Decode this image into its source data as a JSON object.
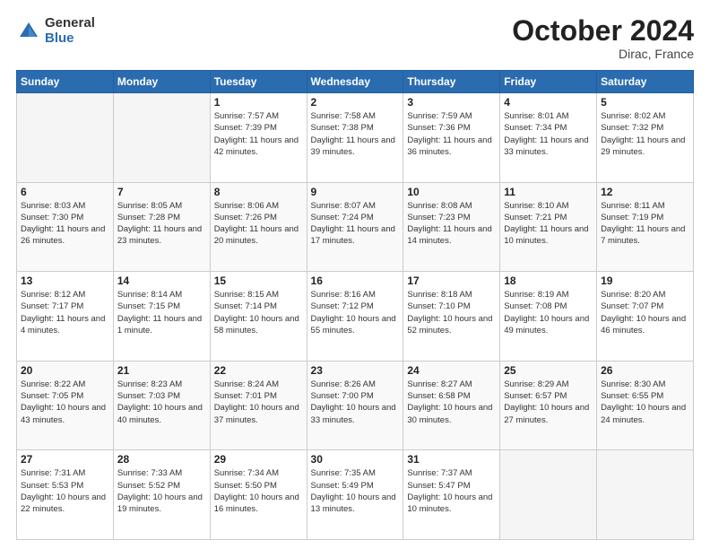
{
  "header": {
    "logo_general": "General",
    "logo_blue": "Blue",
    "month_title": "October 2024",
    "location": "Dirac, France"
  },
  "days_of_week": [
    "Sunday",
    "Monday",
    "Tuesday",
    "Wednesday",
    "Thursday",
    "Friday",
    "Saturday"
  ],
  "weeks": [
    [
      {
        "day": "",
        "empty": true
      },
      {
        "day": "",
        "empty": true
      },
      {
        "day": "1",
        "sunrise": "7:57 AM",
        "sunset": "7:39 PM",
        "daylight": "11 hours and 42 minutes."
      },
      {
        "day": "2",
        "sunrise": "7:58 AM",
        "sunset": "7:38 PM",
        "daylight": "11 hours and 39 minutes."
      },
      {
        "day": "3",
        "sunrise": "7:59 AM",
        "sunset": "7:36 PM",
        "daylight": "11 hours and 36 minutes."
      },
      {
        "day": "4",
        "sunrise": "8:01 AM",
        "sunset": "7:34 PM",
        "daylight": "11 hours and 33 minutes."
      },
      {
        "day": "5",
        "sunrise": "8:02 AM",
        "sunset": "7:32 PM",
        "daylight": "11 hours and 29 minutes."
      }
    ],
    [
      {
        "day": "6",
        "sunrise": "8:03 AM",
        "sunset": "7:30 PM",
        "daylight": "11 hours and 26 minutes."
      },
      {
        "day": "7",
        "sunrise": "8:05 AM",
        "sunset": "7:28 PM",
        "daylight": "11 hours and 23 minutes."
      },
      {
        "day": "8",
        "sunrise": "8:06 AM",
        "sunset": "7:26 PM",
        "daylight": "11 hours and 20 minutes."
      },
      {
        "day": "9",
        "sunrise": "8:07 AM",
        "sunset": "7:24 PM",
        "daylight": "11 hours and 17 minutes."
      },
      {
        "day": "10",
        "sunrise": "8:08 AM",
        "sunset": "7:23 PM",
        "daylight": "11 hours and 14 minutes."
      },
      {
        "day": "11",
        "sunrise": "8:10 AM",
        "sunset": "7:21 PM",
        "daylight": "11 hours and 10 minutes."
      },
      {
        "day": "12",
        "sunrise": "8:11 AM",
        "sunset": "7:19 PM",
        "daylight": "11 hours and 7 minutes."
      }
    ],
    [
      {
        "day": "13",
        "sunrise": "8:12 AM",
        "sunset": "7:17 PM",
        "daylight": "11 hours and 4 minutes."
      },
      {
        "day": "14",
        "sunrise": "8:14 AM",
        "sunset": "7:15 PM",
        "daylight": "11 hours and 1 minute."
      },
      {
        "day": "15",
        "sunrise": "8:15 AM",
        "sunset": "7:14 PM",
        "daylight": "10 hours and 58 minutes."
      },
      {
        "day": "16",
        "sunrise": "8:16 AM",
        "sunset": "7:12 PM",
        "daylight": "10 hours and 55 minutes."
      },
      {
        "day": "17",
        "sunrise": "8:18 AM",
        "sunset": "7:10 PM",
        "daylight": "10 hours and 52 minutes."
      },
      {
        "day": "18",
        "sunrise": "8:19 AM",
        "sunset": "7:08 PM",
        "daylight": "10 hours and 49 minutes."
      },
      {
        "day": "19",
        "sunrise": "8:20 AM",
        "sunset": "7:07 PM",
        "daylight": "10 hours and 46 minutes."
      }
    ],
    [
      {
        "day": "20",
        "sunrise": "8:22 AM",
        "sunset": "7:05 PM",
        "daylight": "10 hours and 43 minutes."
      },
      {
        "day": "21",
        "sunrise": "8:23 AM",
        "sunset": "7:03 PM",
        "daylight": "10 hours and 40 minutes."
      },
      {
        "day": "22",
        "sunrise": "8:24 AM",
        "sunset": "7:01 PM",
        "daylight": "10 hours and 37 minutes."
      },
      {
        "day": "23",
        "sunrise": "8:26 AM",
        "sunset": "7:00 PM",
        "daylight": "10 hours and 33 minutes."
      },
      {
        "day": "24",
        "sunrise": "8:27 AM",
        "sunset": "6:58 PM",
        "daylight": "10 hours and 30 minutes."
      },
      {
        "day": "25",
        "sunrise": "8:29 AM",
        "sunset": "6:57 PM",
        "daylight": "10 hours and 27 minutes."
      },
      {
        "day": "26",
        "sunrise": "8:30 AM",
        "sunset": "6:55 PM",
        "daylight": "10 hours and 24 minutes."
      }
    ],
    [
      {
        "day": "27",
        "sunrise": "7:31 AM",
        "sunset": "5:53 PM",
        "daylight": "10 hours and 22 minutes."
      },
      {
        "day": "28",
        "sunrise": "7:33 AM",
        "sunset": "5:52 PM",
        "daylight": "10 hours and 19 minutes."
      },
      {
        "day": "29",
        "sunrise": "7:34 AM",
        "sunset": "5:50 PM",
        "daylight": "10 hours and 16 minutes."
      },
      {
        "day": "30",
        "sunrise": "7:35 AM",
        "sunset": "5:49 PM",
        "daylight": "10 hours and 13 minutes."
      },
      {
        "day": "31",
        "sunrise": "7:37 AM",
        "sunset": "5:47 PM",
        "daylight": "10 hours and 10 minutes."
      },
      {
        "day": "",
        "empty": true
      },
      {
        "day": "",
        "empty": true
      }
    ]
  ]
}
